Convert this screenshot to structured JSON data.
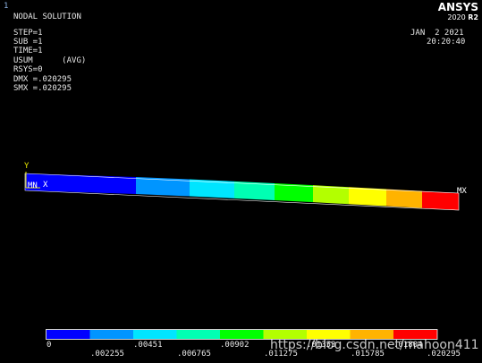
{
  "window": {
    "index": "1",
    "brand": "ANSYS",
    "version_year": "2020",
    "version_release": "R2"
  },
  "header": {
    "title": "NODAL SOLUTION",
    "lines": [
      "STEP=1",
      "SUB =1",
      "TIME=1",
      "USUM      (AVG)",
      "RSYS=0",
      "DMX =.020295",
      "SMX =.020295"
    ],
    "date": "JAN  2 2021",
    "time": "20:20:40"
  },
  "model": {
    "axis_y": "Y",
    "axis_x": "X",
    "min_node_label": "MN",
    "max_node_label": "MX",
    "bands": [
      "#0000ff",
      "#0095ff",
      "#00e5ff",
      "#00ffb3",
      "#00ff00",
      "#b3ff00",
      "#ffff00",
      "#ffb300",
      "#ff0000"
    ]
  },
  "legend": {
    "colors": [
      "#0000ff",
      "#0095ff",
      "#00e5ff",
      "#00ffb3",
      "#00ff00",
      "#b3ff00",
      "#ffff00",
      "#ffb300",
      "#ff0000"
    ],
    "top_labels": [
      "0",
      ".00451",
      ".00902",
      ".01353",
      ".01804"
    ],
    "bottom_labels": [
      ".002255",
      ".006765",
      ".011275",
      ".015785",
      ".020295"
    ]
  },
  "watermark": "https://blog.csdn.net/mahoon411"
}
